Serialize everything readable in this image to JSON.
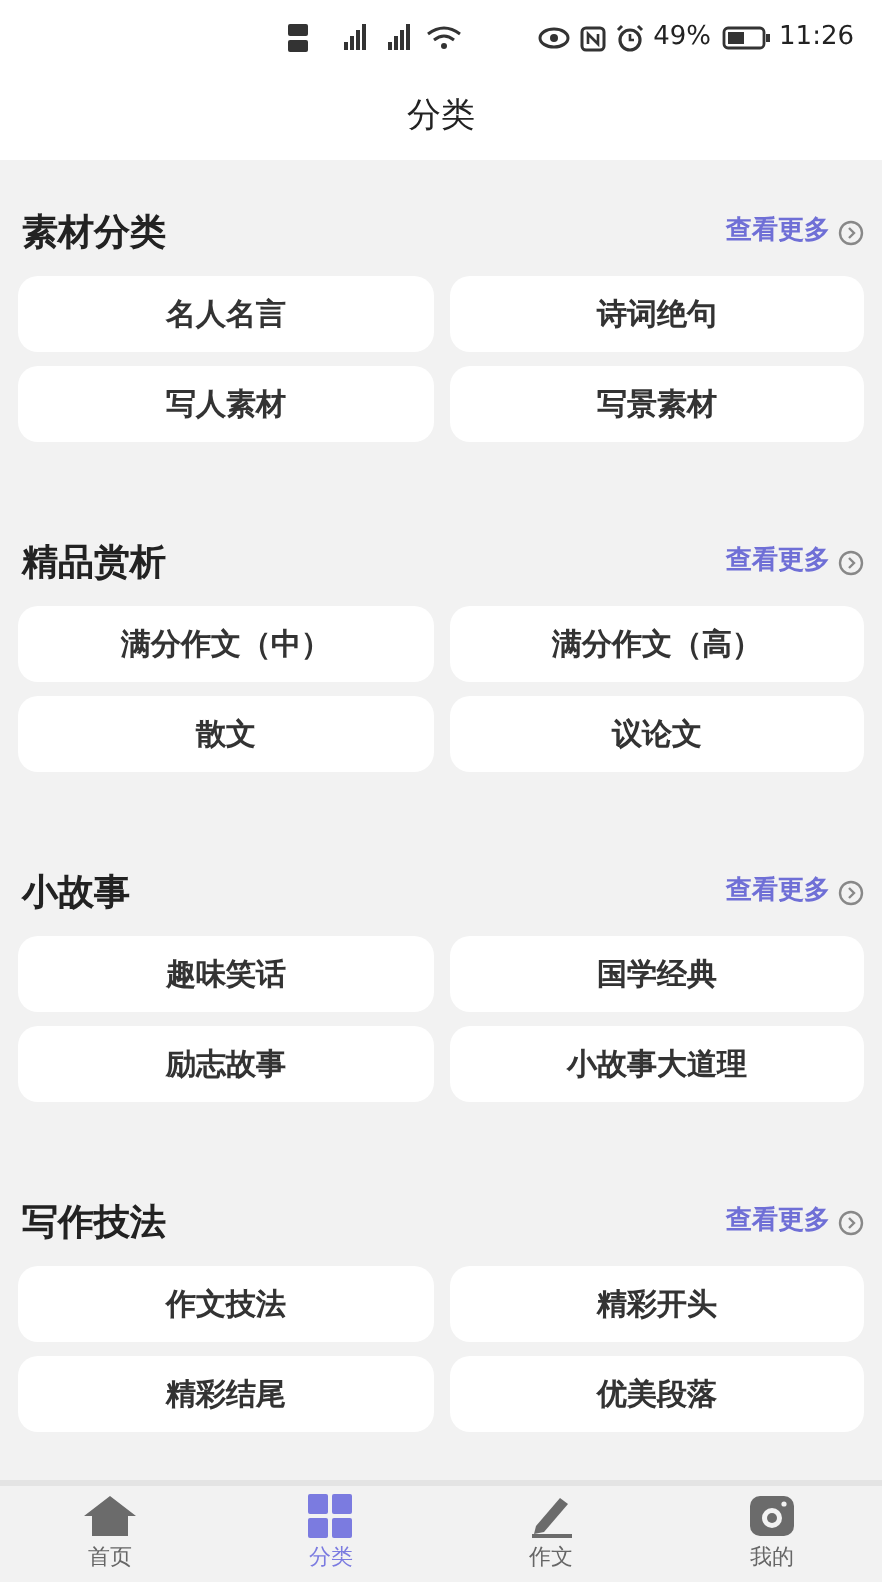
{
  "status_bar": {
    "battery": "49%",
    "time": "11:26"
  },
  "title": "分类",
  "sections": [
    {
      "title": "素材分类",
      "more": "查看更多",
      "items": [
        "名人名言",
        "诗词绝句",
        "写人素材",
        "写景素材"
      ]
    },
    {
      "title": "精品赏析",
      "more": "查看更多",
      "items": [
        "满分作文（中）",
        "满分作文（高）",
        "散文",
        "议论文"
      ]
    },
    {
      "title": "小故事",
      "more": "查看更多",
      "items": [
        "趣味笑话",
        "国学经典",
        "励志故事",
        "小故事大道理"
      ]
    },
    {
      "title": "写作技法",
      "more": "查看更多",
      "items": [
        "作文技法",
        "精彩开头",
        "精彩结尾",
        "优美段落"
      ]
    }
  ],
  "tabs": [
    {
      "label": "首页",
      "kind": "home",
      "selected": false
    },
    {
      "label": "分类",
      "kind": "grid",
      "selected": true
    },
    {
      "label": "作文",
      "kind": "pen",
      "selected": false
    },
    {
      "label": "我的",
      "kind": "camera",
      "selected": false
    }
  ]
}
